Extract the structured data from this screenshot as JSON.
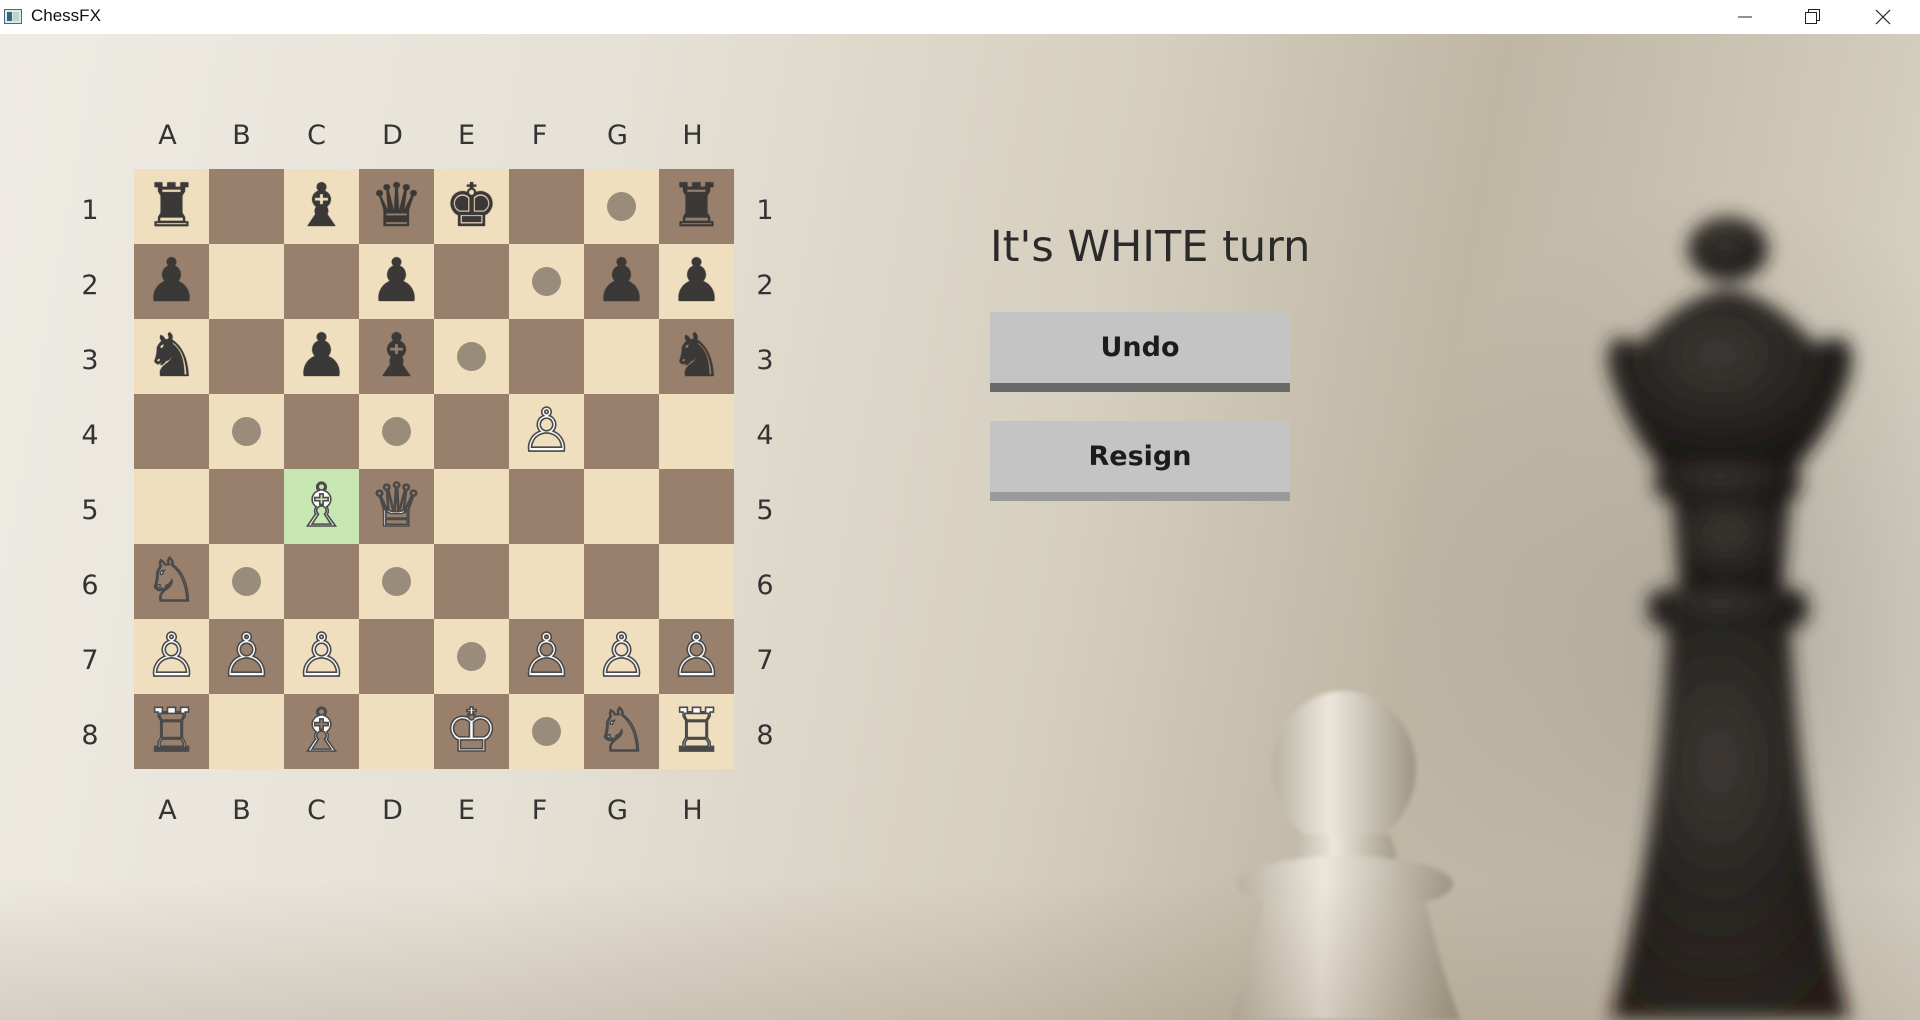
{
  "window": {
    "title": "ChessFX"
  },
  "board": {
    "files": [
      "A",
      "B",
      "C",
      "D",
      "E",
      "F",
      "G",
      "H"
    ],
    "ranks": [
      "1",
      "2",
      "3",
      "4",
      "5",
      "6",
      "7",
      "8"
    ],
    "colors": {
      "light": "#efdfbf",
      "dark": "#98806c",
      "selected": "#c6e6b2",
      "hint": "#9a8c7a"
    },
    "selected_square": "C5",
    "squares": [
      [
        {
          "piece": "♜",
          "color": "black",
          "name": "black-rook"
        },
        {
          "piece": "",
          "hint": false
        },
        {
          "piece": "♝",
          "color": "black",
          "name": "black-bishop"
        },
        {
          "piece": "♛",
          "color": "black",
          "name": "black-queen"
        },
        {
          "piece": "♚",
          "color": "black",
          "name": "black-king"
        },
        {
          "piece": "",
          "hint": false
        },
        {
          "piece": "",
          "hint": true
        },
        {
          "piece": "♜",
          "color": "black",
          "name": "black-rook"
        }
      ],
      [
        {
          "piece": "♟",
          "color": "black",
          "name": "black-pawn"
        },
        {
          "piece": "",
          "hint": false
        },
        {
          "piece": "",
          "hint": false
        },
        {
          "piece": "♟",
          "color": "black",
          "name": "black-pawn"
        },
        {
          "piece": "",
          "hint": false
        },
        {
          "piece": "",
          "hint": true
        },
        {
          "piece": "♟",
          "color": "black",
          "name": "black-pawn"
        },
        {
          "piece": "♟",
          "color": "black",
          "name": "black-pawn"
        }
      ],
      [
        {
          "piece": "♞",
          "color": "black",
          "name": "black-knight"
        },
        {
          "piece": "",
          "hint": false
        },
        {
          "piece": "♟",
          "color": "black",
          "name": "black-pawn"
        },
        {
          "piece": "♝",
          "color": "black",
          "name": "black-bishop"
        },
        {
          "piece": "",
          "hint": true
        },
        {
          "piece": "",
          "hint": false
        },
        {
          "piece": "",
          "hint": false
        },
        {
          "piece": "♞",
          "color": "black",
          "name": "black-knight"
        }
      ],
      [
        {
          "piece": "",
          "hint": false
        },
        {
          "piece": "",
          "hint": true
        },
        {
          "piece": "",
          "hint": false
        },
        {
          "piece": "",
          "hint": true
        },
        {
          "piece": "",
          "hint": false
        },
        {
          "piece": "♙",
          "color": "white",
          "name": "white-pawn"
        },
        {
          "piece": "",
          "hint": false
        },
        {
          "piece": "",
          "hint": false
        }
      ],
      [
        {
          "piece": "",
          "hint": false
        },
        {
          "piece": "",
          "hint": false
        },
        {
          "piece": "♗",
          "color": "white",
          "name": "white-bishop",
          "selected": true
        },
        {
          "piece": "♕",
          "color": "white",
          "name": "white-queen"
        },
        {
          "piece": "",
          "hint": false
        },
        {
          "piece": "",
          "hint": false
        },
        {
          "piece": "",
          "hint": false
        },
        {
          "piece": "",
          "hint": false
        }
      ],
      [
        {
          "piece": "♘",
          "color": "white",
          "name": "white-knight"
        },
        {
          "piece": "",
          "hint": true
        },
        {
          "piece": "",
          "hint": false
        },
        {
          "piece": "",
          "hint": true
        },
        {
          "piece": "",
          "hint": false
        },
        {
          "piece": "",
          "hint": false
        },
        {
          "piece": "",
          "hint": false
        },
        {
          "piece": "",
          "hint": false
        }
      ],
      [
        {
          "piece": "♙",
          "color": "white",
          "name": "white-pawn"
        },
        {
          "piece": "♙",
          "color": "white",
          "name": "white-pawn"
        },
        {
          "piece": "♙",
          "color": "white",
          "name": "white-pawn"
        },
        {
          "piece": "",
          "hint": false
        },
        {
          "piece": "",
          "hint": true
        },
        {
          "piece": "♙",
          "color": "white",
          "name": "white-pawn"
        },
        {
          "piece": "♙",
          "color": "white",
          "name": "white-pawn"
        },
        {
          "piece": "♙",
          "color": "white",
          "name": "white-pawn"
        }
      ],
      [
        {
          "piece": "♖",
          "color": "white",
          "name": "white-rook"
        },
        {
          "piece": "",
          "hint": false
        },
        {
          "piece": "♗",
          "color": "white",
          "name": "white-bishop"
        },
        {
          "piece": "",
          "hint": false
        },
        {
          "piece": "♔",
          "color": "white",
          "name": "white-king"
        },
        {
          "piece": "",
          "hint": true
        },
        {
          "piece": "♘",
          "color": "white",
          "name": "white-knight"
        },
        {
          "piece": "♖",
          "color": "white",
          "name": "white-rook"
        }
      ]
    ]
  },
  "panel": {
    "turn_text": "It's WHITE turn",
    "undo_label": "Undo",
    "resign_label": "Resign"
  }
}
